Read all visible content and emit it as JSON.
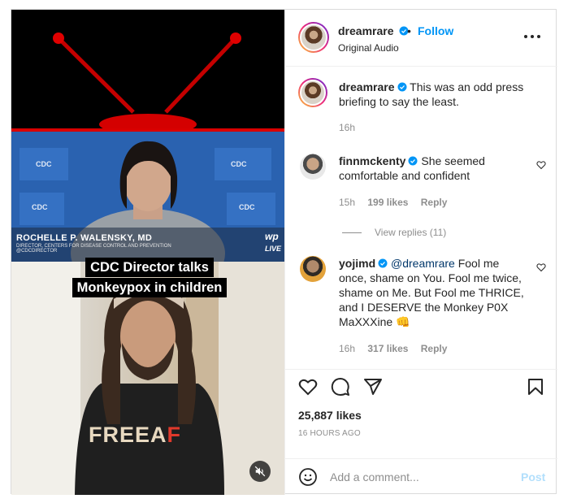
{
  "post": {
    "author": {
      "username": "dreamrare",
      "follow_label": "Follow",
      "separator": "•",
      "audio_label": "Original Audio",
      "more_icon": "more-horizontal-icon"
    },
    "media": {
      "caption_lines": [
        "CDC Director talks",
        "Monkeypox in children"
      ],
      "lower_third_name": "ROCHELLE P. WALENSKY, MD",
      "lower_third_title": "DIRECTOR, CENTERS FOR DISEASE CONTROL AND PREVENTION",
      "lower_third_handle": "@CDCDIRECTOR",
      "backdrop_logo": "CDC",
      "network_logo": "wp",
      "network_live": "LIVE",
      "shirt_text_main": "FREEA",
      "shirt_text_accent": "F",
      "mute_icon": "muted-speaker-icon"
    },
    "caption": {
      "username": "dreamrare",
      "text": "This was an odd press briefing to say the least.",
      "time": "16h"
    },
    "comments": [
      {
        "username": "finnmckenty",
        "text": "She seemed comfortable and confident",
        "time": "15h",
        "likes": "199 likes",
        "reply_label": "Reply",
        "view_replies": "View replies (11)"
      },
      {
        "username": "yojimd",
        "mention": "@dreamrare",
        "text": "Fool me once, shame on You. Fool me twice, shame on Me. But Fool me THRICE, and I DESERVE the Monkey P0X MaXXXine 👊",
        "time": "16h",
        "likes": "317 likes",
        "reply_label": "Reply"
      }
    ],
    "actions": {
      "like_icon": "heart-icon",
      "comment_icon": "comment-bubble-icon",
      "share_icon": "paper-plane-icon",
      "save_icon": "bookmark-icon"
    },
    "likes_count": "25,887 likes",
    "posted_ago": "16 HOURS AGO",
    "add_comment": {
      "emoji_icon": "smiley-icon",
      "placeholder": "Add a comment...",
      "post_label": "Post"
    }
  },
  "colors": {
    "link_blue": "#0095f6",
    "post_disabled": "#b2dffc",
    "muted_text": "#8e8e8e",
    "mention": "#00376b",
    "verified_blue": "#0095f6"
  }
}
